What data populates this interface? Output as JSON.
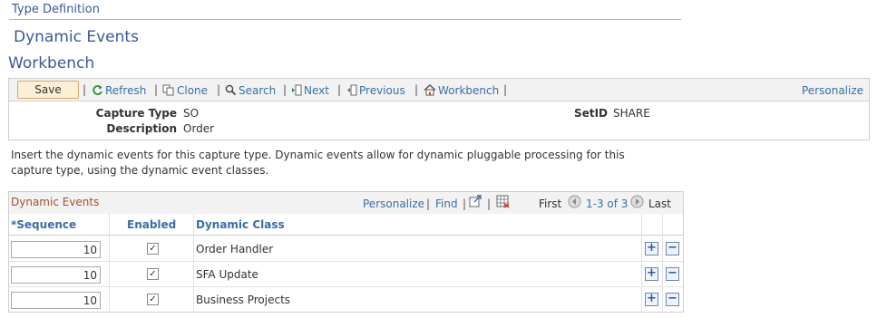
{
  "breadcrumb": "Type Definition",
  "page_title": "Dynamic Events",
  "page_subtitle": "Workbench",
  "toolbar": {
    "save": "Save",
    "refresh": "Refresh",
    "clone": "Clone",
    "search": "Search",
    "next": "Next",
    "previous": "Previous",
    "workbench": "Workbench",
    "personalize": "Personalize"
  },
  "header": {
    "capture_type_label": "Capture Type",
    "capture_type_value": "SO",
    "description_label": "Description",
    "description_value": "Order",
    "setid_label": "SetID",
    "setid_value": "SHARE"
  },
  "instructions": "Insert the dynamic events for this capture type. Dynamic events allow for dynamic pluggable processing for this capture type, using the dynamic event classes.",
  "grid": {
    "title": "Dynamic Events",
    "personalize": "Personalize",
    "find": "Find",
    "first": "First",
    "range": "1-3 of 3",
    "last": "Last",
    "columns": {
      "sequence": "*Sequence",
      "enabled": "Enabled",
      "dynamic_class": "Dynamic Class"
    },
    "rows": [
      {
        "sequence": "10",
        "enabled": true,
        "dynamic_class": "Order Handler"
      },
      {
        "sequence": "10",
        "enabled": true,
        "dynamic_class": "SFA Update"
      },
      {
        "sequence": "10",
        "enabled": true,
        "dynamic_class": "Business Projects"
      }
    ]
  },
  "colors": {
    "link": "#3a6ea5",
    "title": "#3b5998",
    "grid_title": "#a0522d",
    "save_bg": "#fcefd6"
  }
}
